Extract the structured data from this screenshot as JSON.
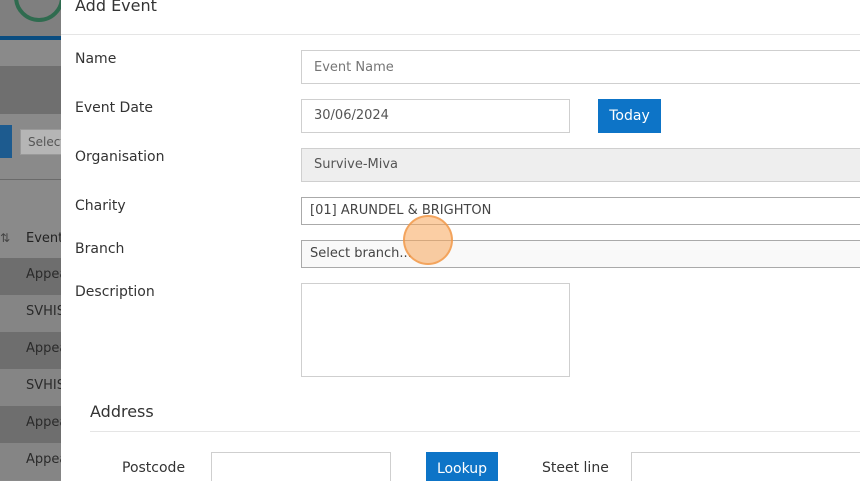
{
  "background_page": {
    "select_partial": "Select",
    "table_header_label": "Event",
    "table_header_icon": "sort-icon",
    "rows": [
      "Appea",
      "SVHIS",
      "Appea",
      "SVHIS",
      "Appea",
      "Appea"
    ]
  },
  "modal": {
    "title": "Add Event",
    "fields": {
      "name": {
        "label": "Name",
        "placeholder": "Event Name",
        "value": ""
      },
      "event_date": {
        "label": "Event Date",
        "value": "30/06/2024",
        "today_button": "Today"
      },
      "organisation": {
        "label": "Organisation",
        "value": "Survive-Miva"
      },
      "charity": {
        "label": "Charity",
        "value": "[01] ARUNDEL & BRIGHTON"
      },
      "branch": {
        "label": "Branch",
        "value": "Select branch..."
      },
      "description": {
        "label": "Description",
        "value": ""
      }
    },
    "address": {
      "title": "Address",
      "postcode_label": "Postcode",
      "postcode_value": "",
      "lookup_button": "Lookup",
      "street_label": "Steet line",
      "street_value": ""
    }
  },
  "colors": {
    "primary": "#0d74c7",
    "overlay": "#7a7a7a",
    "click_marker": "#f7a55a"
  }
}
